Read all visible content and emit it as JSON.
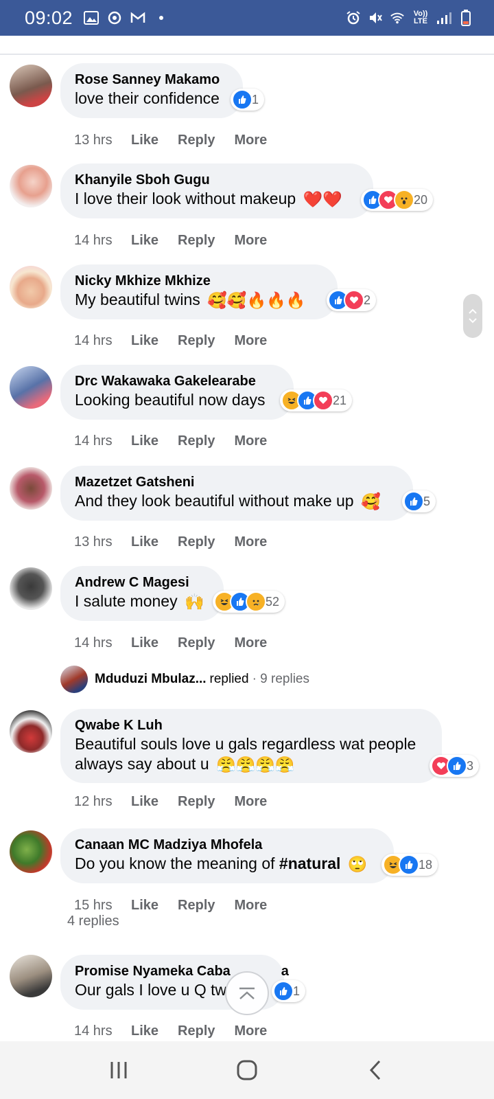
{
  "status_bar": {
    "time": "09:02",
    "left_icons": [
      "gallery-icon",
      "sync-icon",
      "gmail-icon",
      "dot-icon"
    ],
    "right_icons": [
      "alarm-icon",
      "mute-icon",
      "wifi-icon",
      "volte-icon",
      "signal-icon",
      "battery-icon"
    ],
    "volte_label": "Vo)) LTE"
  },
  "comments": [
    {
      "author": "Rose Sanney Makamo",
      "text": "love their confidence",
      "emojis": "",
      "reactions": [
        "like"
      ],
      "count": "1",
      "time": "13 hrs"
    },
    {
      "author": "Khanyile Sboh Gugu",
      "text": "I love their look without makeup",
      "emojis": "❤️❤️",
      "reactions": [
        "like",
        "love",
        "wow"
      ],
      "count": "20",
      "time": "14 hrs"
    },
    {
      "author": "Nicky Mkhize Mkhize",
      "text": "My beautiful twins",
      "emojis": "🥰🥰🔥🔥🔥",
      "reactions": [
        "like",
        "love"
      ],
      "count": "2",
      "time": "14 hrs"
    },
    {
      "author": "Drc Wakawaka Gakelearabe",
      "text": "Looking beautiful now days",
      "emojis": "",
      "reactions": [
        "haha",
        "like",
        "love"
      ],
      "count": "21",
      "time": "14 hrs"
    },
    {
      "author": "Mazetzet Gatsheni",
      "text": "And they look beautiful without make up",
      "emojis": "🥰",
      "reactions": [
        "like"
      ],
      "count": "5",
      "time": "13 hrs"
    },
    {
      "author": "Andrew C Magesi",
      "text": "I salute money",
      "emojis": "🙌",
      "reactions": [
        "haha",
        "like",
        "sad"
      ],
      "count": "52",
      "time": "14 hrs"
    },
    {
      "author": "Qwabe K Luh",
      "text": "Beautiful souls love u gals regardless wat people always say about u",
      "emojis": "😤😤😤😤",
      "reactions": [
        "love",
        "like"
      ],
      "count": "3",
      "time": "12 hrs"
    },
    {
      "author": "Canaan MC Madziya Mhofela",
      "text": "Do you know the meaning of",
      "hashtag": "#natural",
      "emojis": "🙄",
      "reactions": [
        "haha",
        "like"
      ],
      "count": "18",
      "time": "15 hrs"
    },
    {
      "author": "Promise Nyameka Caba",
      "author_tail": "a",
      "text": "Our gals I love u Q tw",
      "emojis": "",
      "reactions": [
        "like"
      ],
      "count": "1",
      "time": "14 hrs"
    }
  ],
  "actions": {
    "like": "Like",
    "reply": "Reply",
    "more": "More"
  },
  "reply_preview": {
    "name": "Mduduzi Mbulaz...",
    "verb": "replied",
    "count": "· 9 replies"
  },
  "replies_link": "4 replies",
  "colors": {
    "facebook_blue": "#3b5998",
    "like_blue": "#1877f2",
    "love_red": "#f33e58",
    "bubble_gray": "#f0f2f5",
    "meta_gray": "#65676b"
  }
}
